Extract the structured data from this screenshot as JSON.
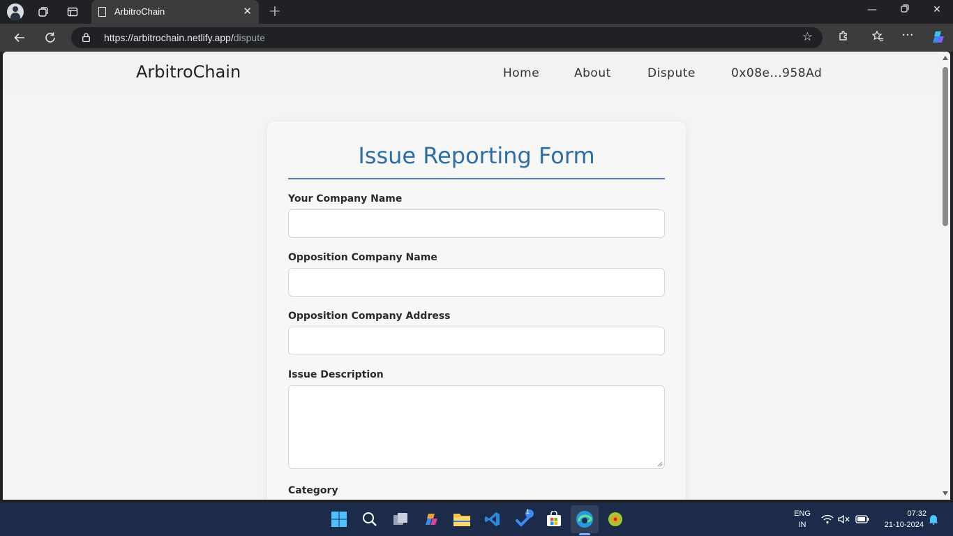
{
  "browser": {
    "tab_title": "ArbitroChain",
    "url_host": "https://arbitrochain.netlify.app/",
    "url_path": "dispute"
  },
  "site": {
    "brand": "ArbitroChain",
    "nav": {
      "home": "Home",
      "about": "About",
      "dispute": "Dispute",
      "wallet": "0x08e...958Ad"
    }
  },
  "form": {
    "title": "Issue Reporting Form",
    "fields": {
      "company_name_label": "Your Company Name",
      "opposition_name_label": "Opposition Company Name",
      "opposition_address_label": "Opposition Company Address",
      "description_label": "Issue Description",
      "category_label": "Category"
    },
    "accent_color": "#2b6ea8"
  },
  "taskbar": {
    "language_top": "ENG",
    "language_bottom": "IN",
    "time": "07:32",
    "date": "21-10-2024",
    "badge_count": "1"
  }
}
